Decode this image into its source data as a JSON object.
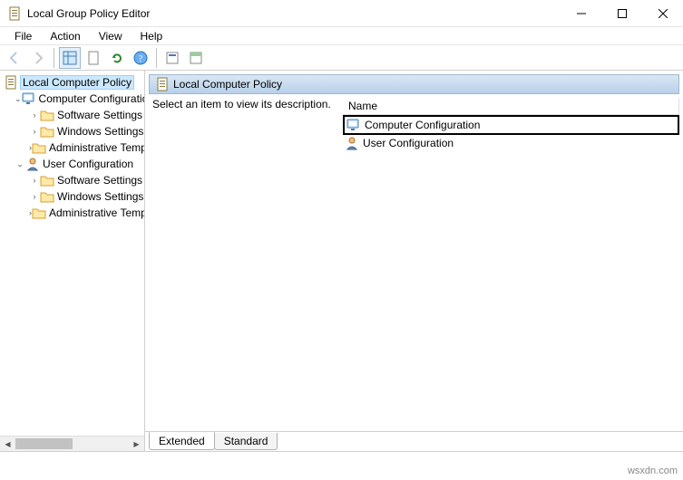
{
  "window": {
    "title": "Local Group Policy Editor"
  },
  "menu": {
    "file": "File",
    "action": "Action",
    "view": "View",
    "help": "Help"
  },
  "tree": {
    "root": "Local Computer Policy",
    "computer": "Computer Configuration",
    "user": "User Configuration",
    "software": "Software Settings",
    "windows": "Windows Settings",
    "admin": "Administrative Templates"
  },
  "panel": {
    "title": "Local Computer Policy",
    "desc": "Select an item to view its description.",
    "name_header": "Name",
    "item_computer": "Computer Configuration",
    "item_user": "User Configuration"
  },
  "tabs": {
    "extended": "Extended",
    "standard": "Standard"
  },
  "watermark": "wsxdn.com"
}
